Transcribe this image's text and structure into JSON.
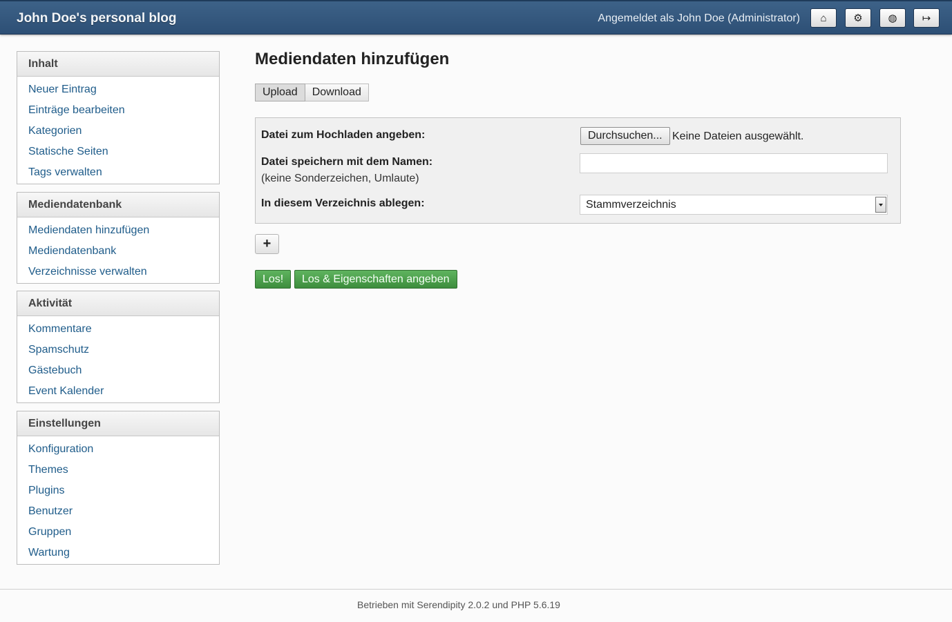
{
  "header": {
    "blog_title": "John Doe's personal blog",
    "user_info": "Angemeldet als John Doe (Administrator)",
    "buttons": [
      {
        "icon": "home-icon",
        "glyph": "⌂"
      },
      {
        "icon": "cogs-icon",
        "glyph": "⚙"
      },
      {
        "icon": "globe-icon",
        "glyph": "◍"
      },
      {
        "icon": "logout-icon",
        "glyph": "↦"
      }
    ]
  },
  "sidebar": {
    "sections": [
      {
        "title": "Inhalt",
        "items": [
          "Neuer Eintrag",
          "Einträge bearbeiten",
          "Kategorien",
          "Statische Seiten",
          "Tags verwalten"
        ]
      },
      {
        "title": "Mediendatenbank",
        "items": [
          "Mediendaten hinzufügen",
          "Mediendatenbank",
          "Verzeichnisse verwalten"
        ]
      },
      {
        "title": "Aktivität",
        "items": [
          "Kommentare",
          "Spamschutz",
          "Gästebuch",
          "Event Kalender"
        ]
      },
      {
        "title": "Einstellungen",
        "items": [
          "Konfiguration",
          "Themes",
          "Plugins",
          "Benutzer",
          "Gruppen",
          "Wartung"
        ]
      }
    ]
  },
  "main": {
    "title": "Mediendaten hinzufügen",
    "tabs": [
      "Upload",
      "Download"
    ],
    "form": {
      "file_label": "Datei zum Hochladen angeben:",
      "browse_label": "Durchsuchen...",
      "file_status": "Keine Dateien ausgewählt.",
      "save_name_label": "Datei speichern mit dem Namen:",
      "save_name_hint": "(keine Sonderzeichen, Umlaute)",
      "save_name_value": "",
      "directory_label": "In diesem Verzeichnis ablegen:",
      "directory_value": "Stammverzeichnis"
    },
    "add_more": "+",
    "submit_label": "Los!",
    "submit_props_label": "Los & Eigenschaften angeben"
  },
  "footer": {
    "text": "Betrieben mit Serendipity 2.0.2 und PHP 5.6.19"
  }
}
